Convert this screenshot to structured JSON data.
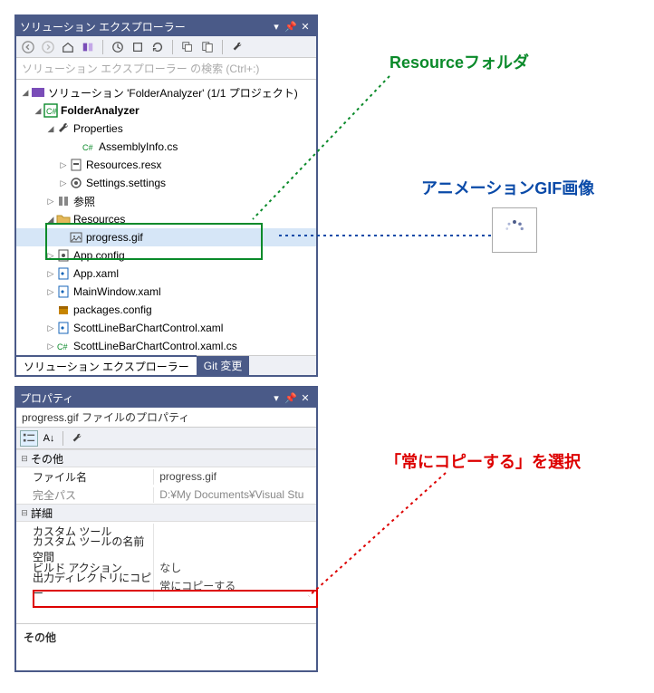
{
  "explorer": {
    "title": "ソリューション エクスプローラー",
    "search_placeholder": "ソリューション エクスプローラー の検索 (Ctrl+:)",
    "solution_label": "ソリューション 'FolderAnalyzer' (1/1 プロジェクト)",
    "tree": {
      "project": "FolderAnalyzer",
      "properties": "Properties",
      "assemblyinfo": "AssemblyInfo.cs",
      "resourcesresx": "Resources.resx",
      "settings": "Settings.settings",
      "references": "参照",
      "resources_folder": "Resources",
      "progressgif": "progress.gif",
      "appconfig": "App.config",
      "appxaml": "App.xaml",
      "mainwindow": "MainWindow.xaml",
      "packages": "packages.config",
      "scottxaml": "ScottLineBarChartControl.xaml",
      "scottcs": "ScottLineBarChartControl.xaml.cs"
    },
    "tabs": {
      "active": "ソリューション エクスプローラー",
      "inactive": "Git 変更"
    }
  },
  "props": {
    "title": "プロパティ",
    "header": "progress.gif ファイルのプロパティ",
    "group_other": "その他",
    "group_detail": "詳細",
    "rows": {
      "filename_k": "ファイル名",
      "filename_v": "progress.gif",
      "fullpath_k": "完全パス",
      "fullpath_v": "D:¥My Documents¥Visual Stu",
      "customtool_k": "カスタム ツール",
      "customtool_v": "",
      "customns_k": "カスタム ツールの名前空間",
      "customns_v": "",
      "buildaction_k": "ビルド アクション",
      "buildaction_v": "なし",
      "copytodir_k": "出力ディレクトリにコピー",
      "copytodir_v": "常にコピーする"
    },
    "desc_title": "その他"
  },
  "annotations": {
    "resource_folder": "Resourceフォルダ",
    "anim_gif": "アニメーションGIF画像",
    "copy_always": "「常にコピーする」を選択"
  }
}
